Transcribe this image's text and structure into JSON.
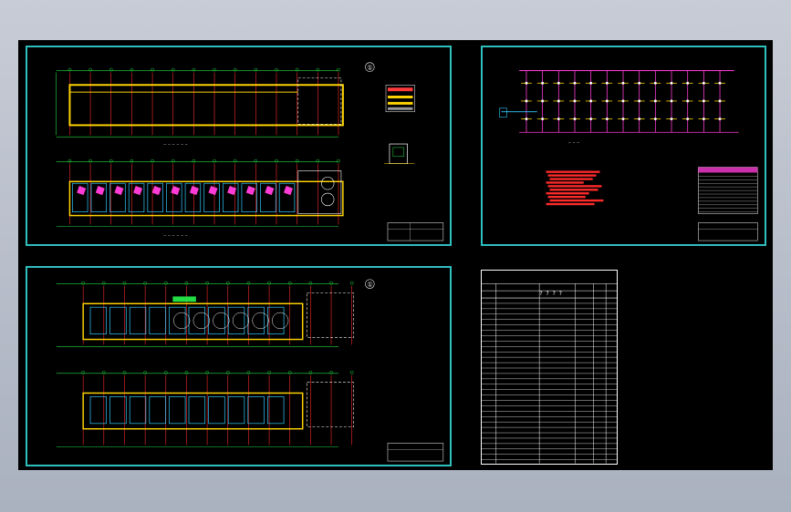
{
  "sheets": [
    {
      "id": "sheet-1",
      "marker": "①"
    },
    {
      "id": "sheet-2"
    },
    {
      "id": "sheet-3",
      "marker": "①"
    },
    {
      "id": "sheet-4",
      "header_chars": "? ? ? ?"
    }
  ],
  "colors": {
    "sheet_border": "#2fbfbf",
    "grid_green": "#22dd44",
    "axis_red": "#ff2a2a",
    "wall_yellow": "#ffd400",
    "room_cyan": "#33ccff",
    "accent_magenta": "#ff3bd6",
    "text_white": "#ffffff"
  }
}
